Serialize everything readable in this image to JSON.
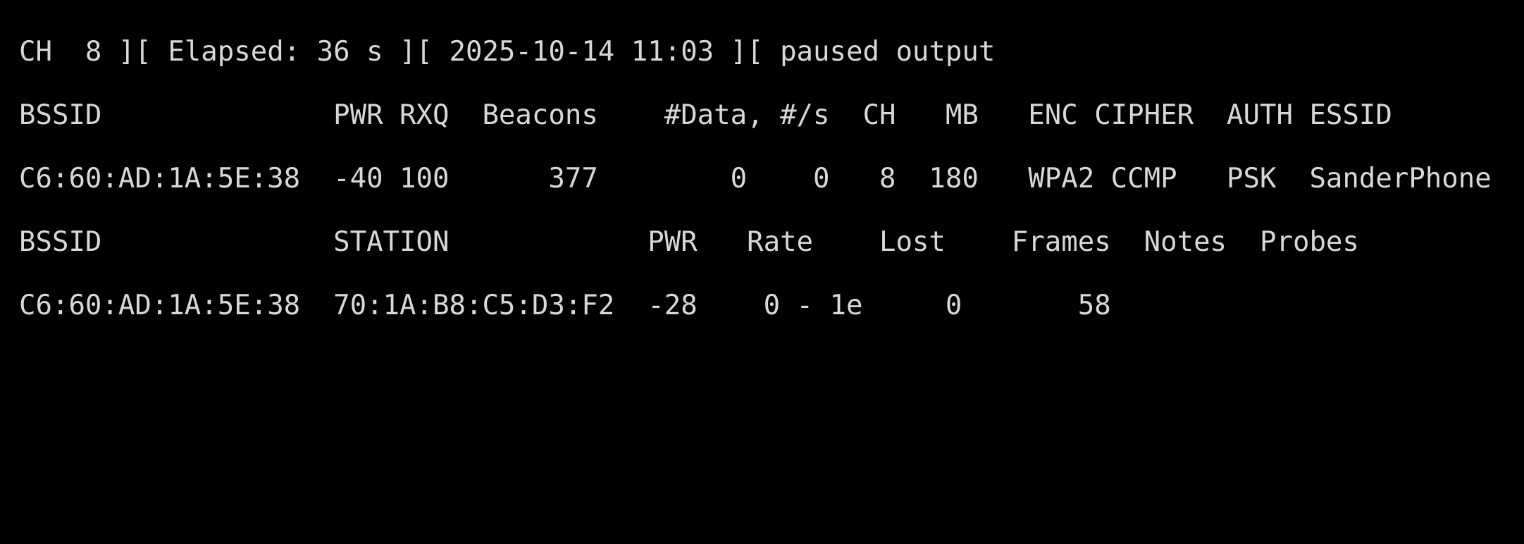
{
  "terminal": {
    "status_line": "CH  8 ][ Elapsed: 36 s ][ 2025-10-14 11:03 ][ paused output",
    "ap_header": "BSSID              PWR RXQ  Beacons    #Data, #/s  CH   MB   ENC CIPHER  AUTH ESSID",
    "ap_rows": [
      "C6:60:AD:1A:5E:38  -40 100      377        0    0   8  180   WPA2 CCMP   PSK  SanderPhone"
    ],
    "station_header": "BSSID              STATION            PWR   Rate    Lost    Frames  Notes  Probes",
    "station_rows": [
      "C6:60:AD:1A:5E:38  70:1A:B8:C5:D3:F2  -28    0 - 1e     0       58"
    ]
  }
}
